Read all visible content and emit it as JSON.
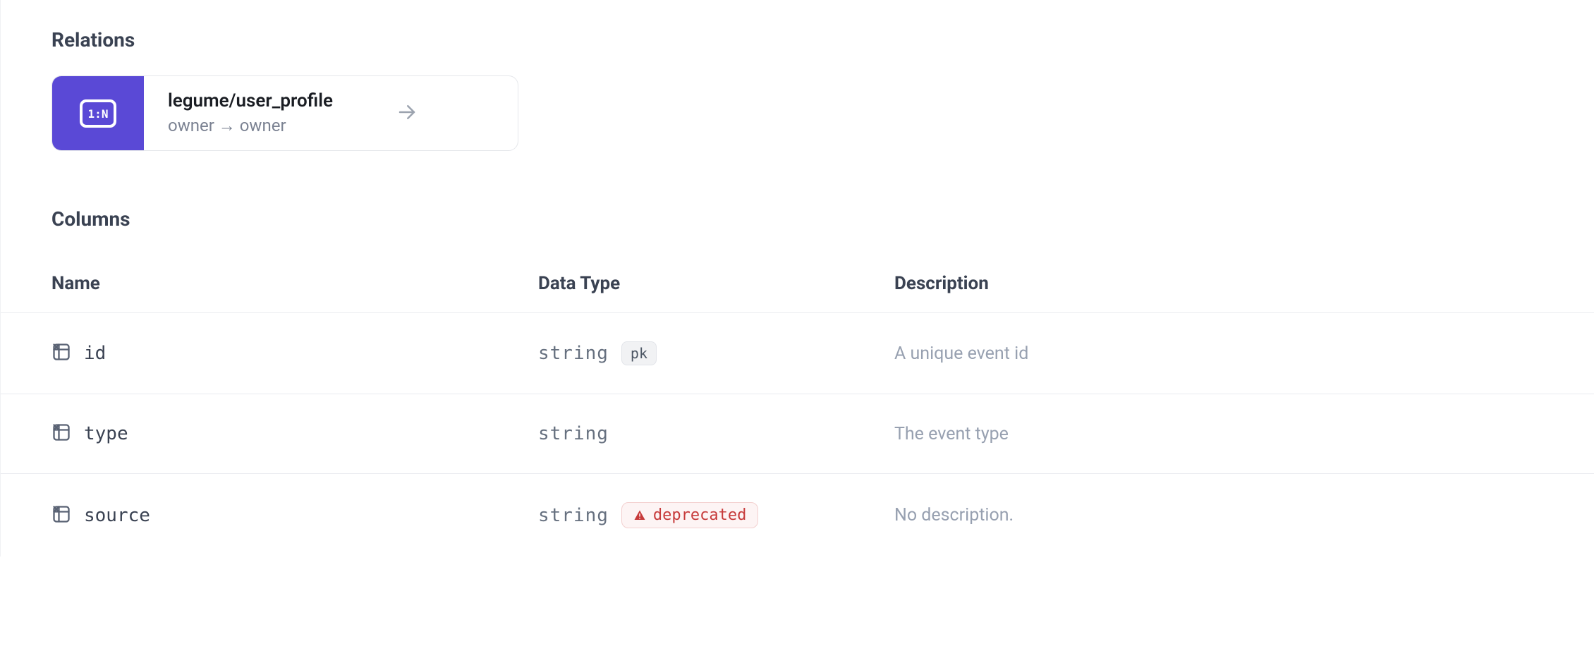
{
  "relations": {
    "heading": "Relations",
    "card": {
      "title": "legume/user_profile",
      "mapping": "owner → owner"
    }
  },
  "columns": {
    "heading": "Columns",
    "headers": {
      "name": "Name",
      "type": "Data Type",
      "desc": "Description"
    },
    "rows": [
      {
        "name": "id",
        "type": "string",
        "pk": "pk",
        "desc": "A unique event id"
      },
      {
        "name": "type",
        "type": "string",
        "desc": "The event type"
      },
      {
        "name": "source",
        "type": "string",
        "flag": "deprecated",
        "desc": "No description."
      }
    ]
  }
}
